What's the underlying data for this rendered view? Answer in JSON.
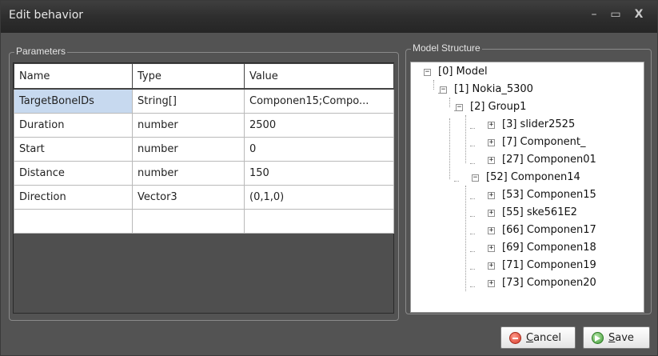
{
  "window": {
    "title": "Edit behavior",
    "min_glyph": "–",
    "max_glyph": "▭",
    "close_glyph": "X"
  },
  "parameters": {
    "legend": "Parameters",
    "headers": [
      "Name",
      "Type",
      "Value"
    ],
    "rows": [
      {
        "name": "TargetBoneIDs",
        "type": "String[]",
        "value": "Componen15;Compo..."
      },
      {
        "name": "Duration",
        "type": "number",
        "value": "2500"
      },
      {
        "name": "Start",
        "type": "number",
        "value": "0"
      },
      {
        "name": "Distance",
        "type": "number",
        "value": "150"
      },
      {
        "name": "Direction",
        "type": "Vector3",
        "value": "(0,1,0)"
      },
      {
        "name": "",
        "type": "",
        "value": ""
      }
    ]
  },
  "model_structure": {
    "legend": "Model Structure",
    "nodes": [
      {
        "label": "[0] Model",
        "expander": "−"
      },
      {
        "label": "[1] Nokia_5300",
        "expander": "−"
      },
      {
        "label": "[2] Group1",
        "expander": "−"
      },
      {
        "label": "[3] slider2525",
        "expander": "+"
      },
      {
        "label": "[7] Component_",
        "expander": "+"
      },
      {
        "label": "[27] Componen01",
        "expander": "+"
      },
      {
        "label": "[52] Componen14",
        "expander": "−"
      },
      {
        "label": "[53] Componen15",
        "expander": "+"
      },
      {
        "label": "[55] ske561E2",
        "expander": "+"
      },
      {
        "label": "[66] Componen17",
        "expander": "+"
      },
      {
        "label": "[69] Componen18",
        "expander": "+"
      },
      {
        "label": "[71] Componen19",
        "expander": "+"
      },
      {
        "label": "[73] Componen20",
        "expander": "+"
      }
    ]
  },
  "buttons": {
    "cancel": {
      "mnemonic": "C",
      "rest": "ancel",
      "icon": "cancel-icon"
    },
    "save": {
      "mnemonic": "S",
      "rest": "ave",
      "icon": "save-icon"
    }
  },
  "colors": {
    "window_bg": "#535353",
    "titlebar": "#2e2e2e",
    "selected_cell": "#c7d9ef"
  }
}
